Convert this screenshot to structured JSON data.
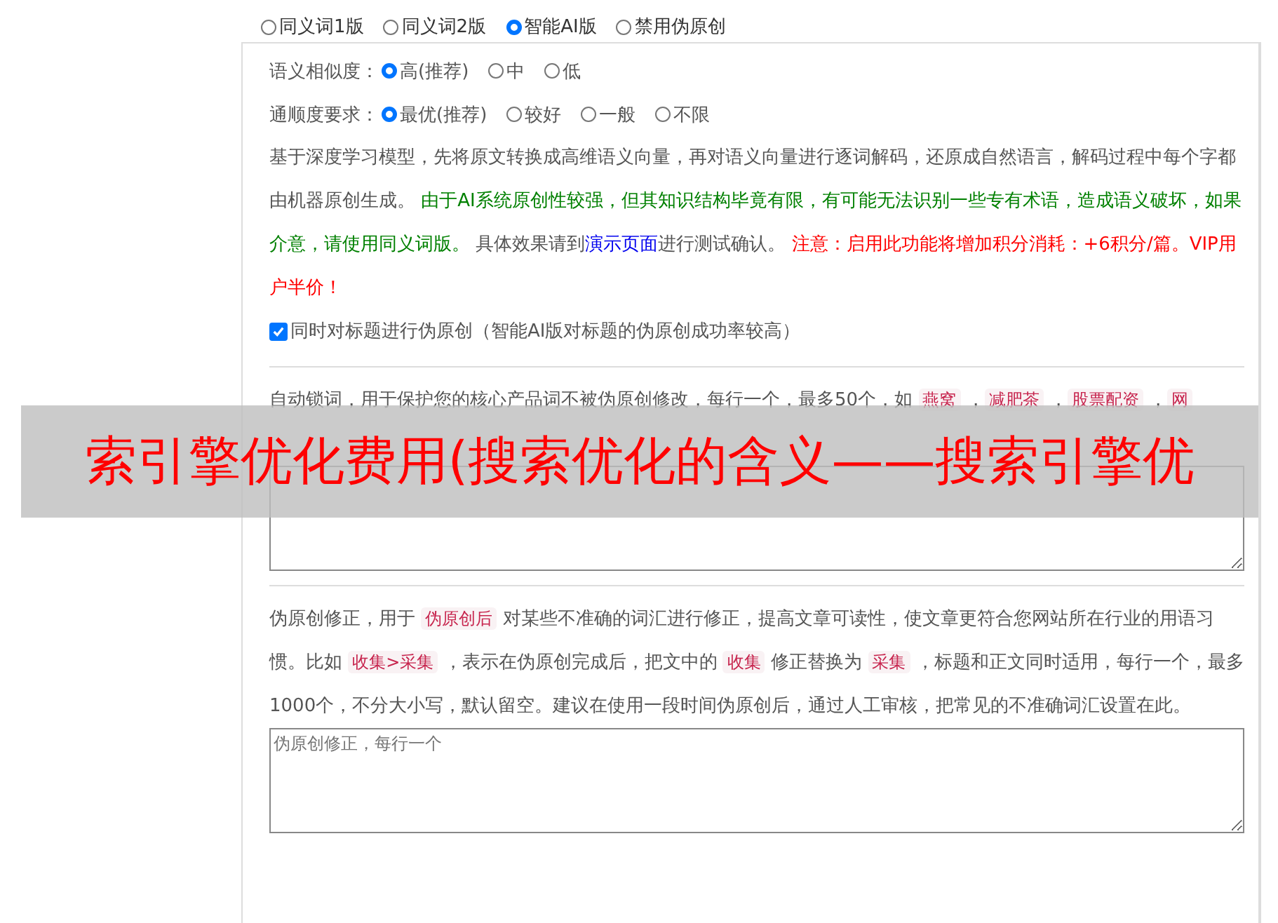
{
  "mode_options": [
    {
      "label": "同义词1版",
      "selected": false
    },
    {
      "label": "同义词2版",
      "selected": false
    },
    {
      "label": "智能AI版",
      "selected": true
    },
    {
      "label": "禁用伪原创",
      "selected": false
    }
  ],
  "similarity": {
    "label": "语义相似度：",
    "options": [
      {
        "label": "高(推荐)",
        "selected": true
      },
      {
        "label": "中",
        "selected": false
      },
      {
        "label": "低",
        "selected": false
      }
    ]
  },
  "fluency": {
    "label": "通顺度要求：",
    "options": [
      {
        "label": "最优(推荐)",
        "selected": true
      },
      {
        "label": "较好",
        "selected": false
      },
      {
        "label": "一般",
        "selected": false
      },
      {
        "label": "不限",
        "selected": false
      }
    ]
  },
  "description": [
    {
      "kind": "plain",
      "text": "基于深度学习模型，先将原文转换成高维语义向量，再对语义向量进行逐词解码，还原成自然语言，解码过程中每个字都由机器原创生成。 "
    },
    {
      "kind": "green",
      "text": "由于AI系统原创性较强，但其知识结构毕竟有限，有可能无法识别一些专有术语，造成语义破坏，如果介意，请使用同义词版。"
    },
    {
      "kind": "plain",
      "text": " 具体效果请到"
    },
    {
      "kind": "link",
      "text": "演示页面"
    },
    {
      "kind": "plain",
      "text": "进行测试确认。 "
    },
    {
      "kind": "red",
      "text": "注意：启用此功能将增加积分消耗：+6积分/篇。VIP用户半价！"
    }
  ],
  "title_option": {
    "label": "同时对标题进行伪原创（智能AI版对标题的伪原创成功率较高）",
    "checked": true
  },
  "lock_words": {
    "segments": [
      {
        "kind": "plain",
        "text": "自动锁词，用于保护您的核心产品词不被伪原创修改，每行一个，最多50个，如 "
      },
      {
        "kind": "code",
        "text": "燕窝"
      },
      {
        "kind": "plain",
        "text": " ，"
      },
      {
        "kind": "code",
        "text": "减肥茶"
      },
      {
        "kind": "plain",
        "text": " ，"
      },
      {
        "kind": "code",
        "text": "股票配资"
      },
      {
        "kind": "plain",
        "text": " ，"
      },
      {
        "kind": "code",
        "text": "网"
      }
    ]
  },
  "correction": {
    "segments": [
      {
        "kind": "plain",
        "text": "伪原创修正，用于 "
      },
      {
        "kind": "code",
        "text": "伪原创后"
      },
      {
        "kind": "plain",
        "text": " 对某些不准确的词汇进行修正，提高文章可读性，使文章更符合您网站所在行业的用语习惯。比如 "
      },
      {
        "kind": "code",
        "text": "收集>采集"
      },
      {
        "kind": "plain",
        "text": " ，表示在伪原创完成后，把文中的 "
      },
      {
        "kind": "code",
        "text": "收集"
      },
      {
        "kind": "plain",
        "text": " 修正替换为 "
      },
      {
        "kind": "code",
        "text": "采集"
      },
      {
        "kind": "plain",
        "text": " ，标题和正文同时适用，每行一个，最多1000个，不分大小写，默认留空。建议在使用一段时间伪原创后，通过人工审核，把常见的不准确词汇设置在此。"
      }
    ],
    "placeholder": "伪原创修正，每行一个"
  },
  "banner": {
    "text": "索引擎优化费用(搜索优化的含义——搜索引擎优"
  }
}
